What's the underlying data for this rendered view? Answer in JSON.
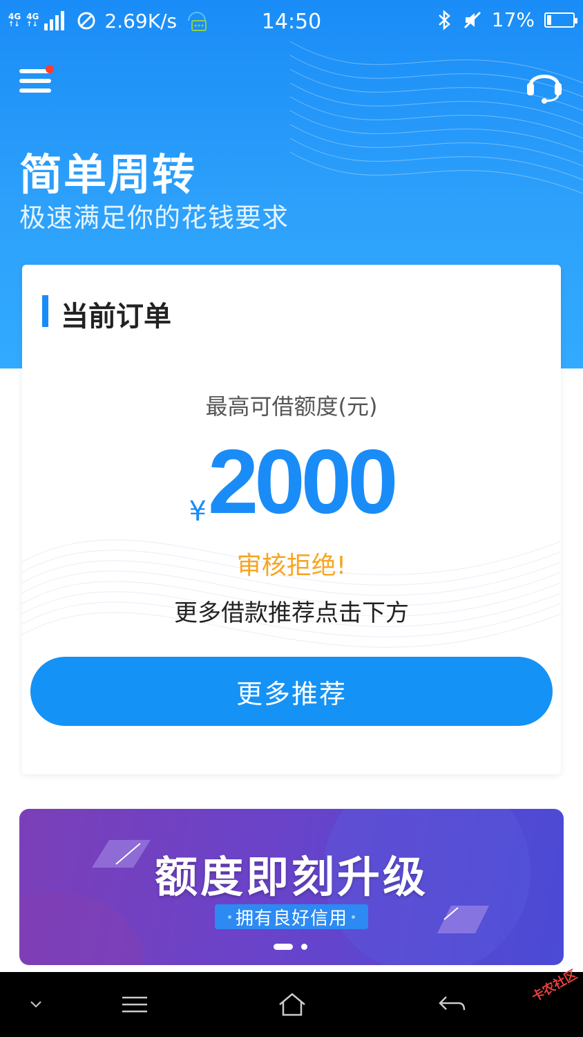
{
  "status_bar": {
    "network_1": "4G",
    "network_2": "4G",
    "speed": "2.69K/s",
    "time": "14:50",
    "battery": "17%",
    "battery_level": 0.17
  },
  "header": {
    "menu_has_notification": true,
    "title": "简单周转",
    "subtitle": "极速满足你的花钱要求"
  },
  "order_card": {
    "title": "当前订单",
    "limit_label": "最高可借额度(元)",
    "currency": "¥",
    "amount": "2000",
    "status": "审核拒绝!",
    "hint": "更多借款推荐点击下方",
    "button_label": "更多推荐"
  },
  "banner": {
    "title": "额度即刻升级",
    "tag": "拥有良好信用",
    "slides": 2,
    "active_slide": 1
  },
  "watermark": "卡农社区",
  "colors": {
    "brand_blue": "#1a8cf7",
    "status_orange": "#f5a623",
    "banner_purple": "#6a43c9"
  }
}
